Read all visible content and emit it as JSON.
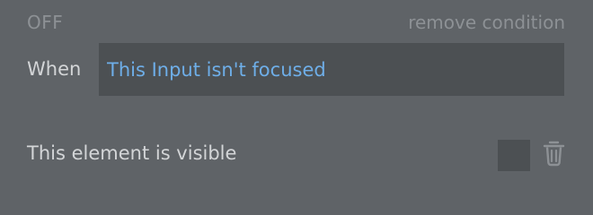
{
  "condition": {
    "state": "OFF",
    "remove_label": "remove condition",
    "when_label": "When",
    "expression": "This Input isn't focused"
  },
  "property": {
    "label": "This element is visible",
    "checked": false
  },
  "icons": {
    "delete": "trash-icon"
  },
  "colors": {
    "background": "#5f6367",
    "field": "#4c5053",
    "expression_text": "#6eaee8",
    "muted_text": "#8d9195",
    "label_text": "#d3d5d7"
  }
}
